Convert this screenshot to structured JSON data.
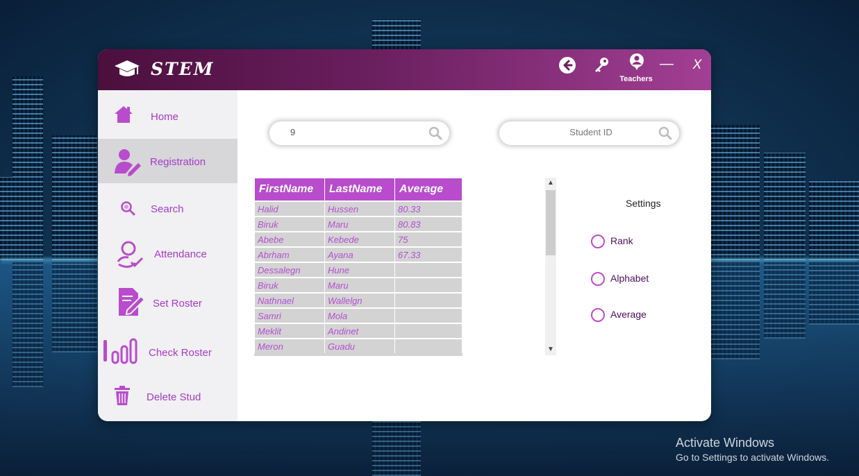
{
  "app": {
    "title": "STEM"
  },
  "titlebar": {
    "user_label": "Teachers",
    "minimize": "—",
    "close": "X"
  },
  "sidebar": {
    "items": [
      {
        "label": "Home",
        "icon": "home-icon"
      },
      {
        "label": "Registration",
        "icon": "user-edit-icon",
        "active": true
      },
      {
        "label": "Search",
        "icon": "search-icon"
      },
      {
        "label": "Attendance",
        "icon": "attendance-icon"
      },
      {
        "label": "Set Roster",
        "icon": "document-edit-icon"
      },
      {
        "label": "Check Roster",
        "icon": "bar-chart-icon"
      },
      {
        "label": "Delete Stud",
        "icon": "trash-icon"
      }
    ]
  },
  "search": {
    "value": "9",
    "placeholder": ""
  },
  "student_id": {
    "value": "",
    "placeholder": "Student ID"
  },
  "table": {
    "headers": [
      "FirstName",
      "LastName",
      "Average"
    ],
    "rows": [
      [
        "Halid",
        "Hussen",
        "80.33"
      ],
      [
        "Biruk",
        "Maru",
        "80.83"
      ],
      [
        "Abebe",
        "Kebede",
        "75"
      ],
      [
        "Abrham",
        "Ayana",
        "67.33"
      ],
      [
        "Dessalegn",
        "Hune",
        ""
      ],
      [
        "Biruk",
        "Maru",
        ""
      ],
      [
        "Nathnael",
        "Wallelgn",
        ""
      ],
      [
        "Samri",
        "Mola",
        ""
      ],
      [
        "Meklit",
        "Andinet",
        ""
      ],
      [
        "Meron",
        "Guadu",
        ""
      ]
    ]
  },
  "settings": {
    "title": "Settings",
    "options": [
      "Rank",
      "Alphabet",
      "Average"
    ]
  },
  "desktop": {
    "activate_title": "Activate Windows",
    "activate_subtitle": "Go to Settings to activate Windows."
  },
  "colors": {
    "accent": "#b84ccc",
    "title_dark": "#4b0f3d",
    "title_light": "#a23f94",
    "nav_text": "#a33cc8"
  }
}
